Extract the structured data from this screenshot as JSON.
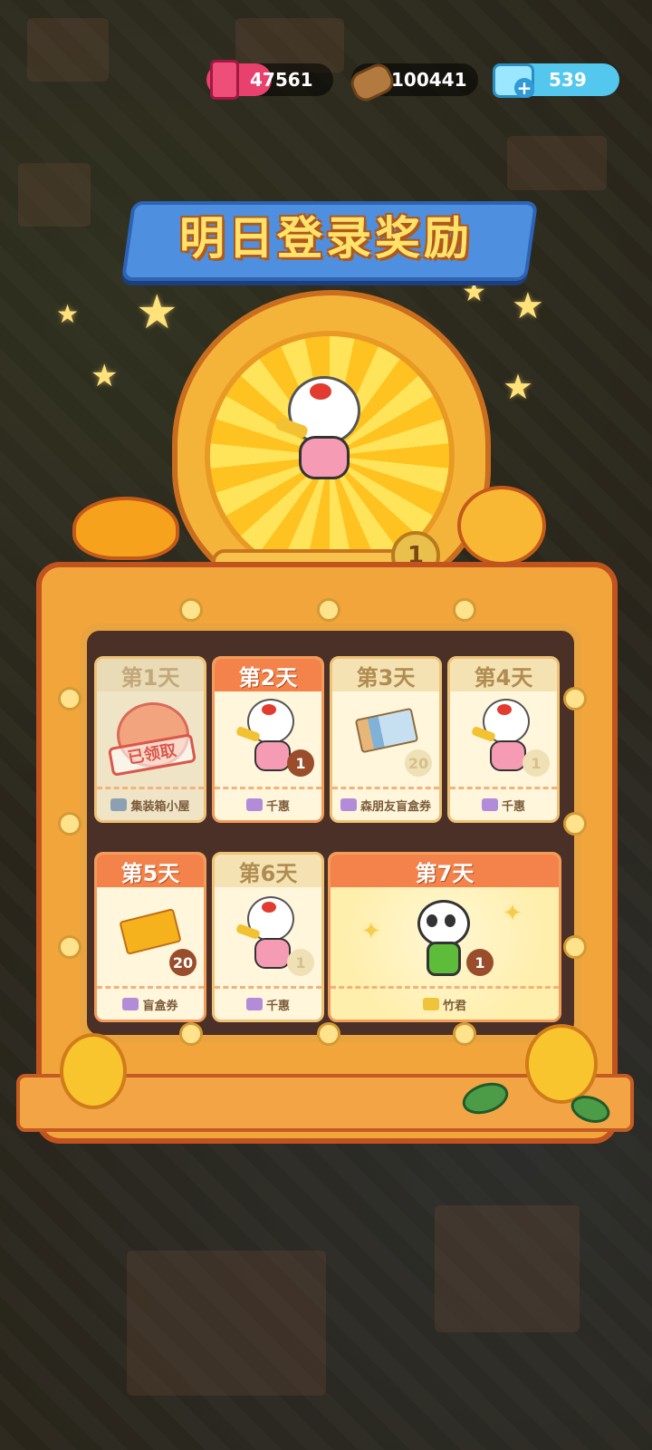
{
  "currencies": [
    {
      "icon": "ink-bottle-icon",
      "value": "47561",
      "color": "#e8416d"
    },
    {
      "icon": "wood-log-icon",
      "value": "100441",
      "color": "#8a5a2b"
    },
    {
      "icon": "gem-plus-icon",
      "value": "539",
      "color": "#46c2e8"
    }
  ],
  "title": "明日登录奖励",
  "featured": {
    "name": "千惠",
    "rank": "3",
    "count": "1"
  },
  "days": [
    {
      "label": "第1天",
      "state": "claimed",
      "item": "集装箱小屋",
      "stamp": "已领取",
      "rank": "",
      "amount": ""
    },
    {
      "label": "第2天",
      "state": "active",
      "item": "千惠",
      "rank": "3",
      "amount": "1"
    },
    {
      "label": "第3天",
      "state": "normal",
      "item": "森朋友盲盒券",
      "rank": "1",
      "amount": "20"
    },
    {
      "label": "第4天",
      "state": "normal",
      "item": "千惠",
      "rank": "3",
      "amount": "1"
    },
    {
      "label": "第5天",
      "state": "active",
      "item": "盲盒券",
      "rank": "1",
      "amount": "20"
    },
    {
      "label": "第6天",
      "state": "normal",
      "item": "千惠",
      "rank": "3",
      "amount": "1"
    },
    {
      "label": "第7天",
      "state": "active",
      "item": "竹君",
      "rank": "3",
      "amount": "1"
    }
  ]
}
